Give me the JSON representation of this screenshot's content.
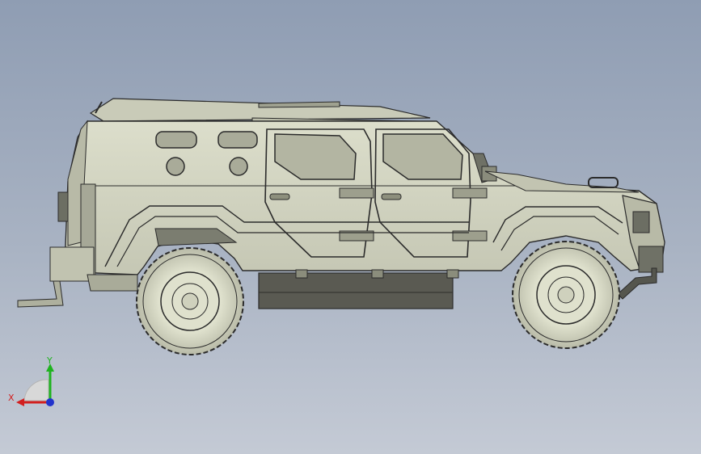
{
  "viewport": {
    "background_top": "#8f9db3",
    "background_bottom": "#c4cad5"
  },
  "model": {
    "body_color": "#d3d5c2",
    "shadow_color": "#b2b4a2",
    "line_color": "#2b2b2b",
    "tire_color": "#d8dbc6",
    "dark_metal": "#5a5a52"
  },
  "triad": {
    "x_label": "X",
    "y_label": "Y",
    "x_color": "#d21f1f",
    "y_color": "#1fb31f",
    "z_color": "#2233cc",
    "icon": "coordinate-triad-icon"
  }
}
